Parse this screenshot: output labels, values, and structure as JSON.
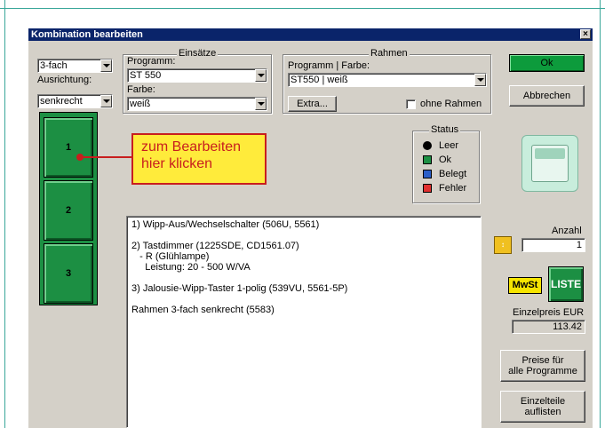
{
  "window": {
    "title": "Kombination bearbeiten",
    "close_label": "×"
  },
  "left": {
    "fach_value": "3-fach",
    "ausrichtung_label": "Ausrichtung:",
    "ausrichtung_value": "senkrecht",
    "slots": [
      "1",
      "2",
      "3"
    ]
  },
  "einsaetze": {
    "group_title": "Einsätze",
    "programm_label": "Programm:",
    "programm_value": "ST 550",
    "farbe_label": "Farbe:",
    "farbe_value": "weiß"
  },
  "rahmen": {
    "group_title": "Rahmen",
    "programm_farbe_label": "Programm | Farbe:",
    "programm_farbe_value": "ST550 | weiß",
    "extra_button": "Extra...",
    "ohne_rahmen_label": "ohne Rahmen"
  },
  "buttons": {
    "ok": "Ok",
    "abbrechen": "Abbrechen",
    "preise_line1": "Preise für",
    "preise_line2": "alle Programme",
    "einzelteile_line1": "Einzelteile",
    "einzelteile_line2": "auflisten",
    "mwst": "MwSt",
    "liste": "LISTE",
    "stueck_icon": "stück-icon"
  },
  "callout": {
    "line1": "zum Bearbeiten",
    "line2": "hier klicken"
  },
  "status": {
    "title": "Status",
    "items": [
      {
        "label": "Leer",
        "color": "#000000"
      },
      {
        "label": "Ok",
        "color": "#1c8f43"
      },
      {
        "label": "Belegt",
        "color": "#2a5ec8"
      },
      {
        "label": "Fehler",
        "color": "#e03030"
      }
    ]
  },
  "details": {
    "text": "1) Wipp-Aus/Wechselschalter (506U, 5561)\n\n2) Tastdimmer (1225SDE, CD1561.07)\n   - R (Glühlampe)\n     Leistung: 20 - 500 W/VA\n\n3) Jalousie-Wipp-Taster 1-polig (539VU, 5561-5P)\n\nRahmen 3-fach senkrecht (5583)"
  },
  "anzahl": {
    "label": "Anzahl",
    "value": "1"
  },
  "preis": {
    "label": "Einzelpreis EUR",
    "value": "113.42"
  }
}
